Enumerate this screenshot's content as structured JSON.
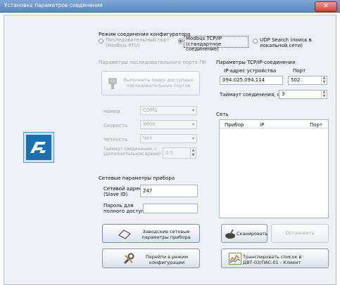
{
  "window": {
    "title": "Установка параметров соединения",
    "close_symbol": "✕"
  },
  "mode": {
    "label": "Режим соединения конфигуратора",
    "options": [
      {
        "line1": "Последовательный порт",
        "line2": "(Modbus RTU)",
        "selected": false
      },
      {
        "line1": "Modbus TCP/IP (стандартное",
        "line2": "соединение)",
        "selected": true
      },
      {
        "line1": "UDP Search (поиск в",
        "line2": "локальной сети)",
        "selected": false
      }
    ]
  },
  "serial": {
    "label": "Параметры последовательного порта ПК",
    "search_btn_line1": "Выполнить поиск доступных",
    "search_btn_line2": "последовательных портов",
    "rows": [
      {
        "label": "Номер",
        "value": "COM1"
      },
      {
        "label": "Скорость",
        "value": "9600"
      },
      {
        "label": "Четность",
        "value": "Чет"
      }
    ],
    "timeout_label_line1": "Таймаут соединения, с",
    "timeout_label_line2": "(дополнительное время)",
    "timeout_value": "0.5"
  },
  "tcp": {
    "label": "Параметры TCP/IP-соединения",
    "ip_label": "IP-адрес устройства",
    "ip_value": "094.025.094.114",
    "port_label": "Порт",
    "port_value": "502",
    "timeout_label": "Таймаут соединения, с",
    "timeout_value": "3"
  },
  "network": {
    "label": "Сеть",
    "columns": [
      "Прибор",
      "IP",
      "Порт"
    ]
  },
  "device": {
    "label": "Сетевые параметры прибора",
    "addr_label_line1": "Сетевой адрес",
    "addr_label_line2": "(Slave ID)",
    "addr_value": "247",
    "pass_label_line1": "Пароль для",
    "pass_label_line2": "полного доступа",
    "pass_value": ""
  },
  "buttons": {
    "factory_line1": "Заводские сетевые",
    "factory_line2": "параметры прибора",
    "config_line1": "Перейти в режим",
    "config_line2": "конфигурации",
    "scan": "Сканировать",
    "stop": "Остановить",
    "translate_line1": "Транслировать список в",
    "translate_line2": "ДВТ-03/ПАС-01 - Клиент"
  },
  "icons": {
    "logo": "app-logo-icon",
    "search": "port-search-icon",
    "factory": "eraser-icon",
    "config": "tools-icon",
    "scan": "scan-icon",
    "translate": "chart-icon"
  },
  "colors": {
    "titlebar": "#5a87c0",
    "logo": "#1b6fb3",
    "selected_radio": "#2c6bd1"
  }
}
